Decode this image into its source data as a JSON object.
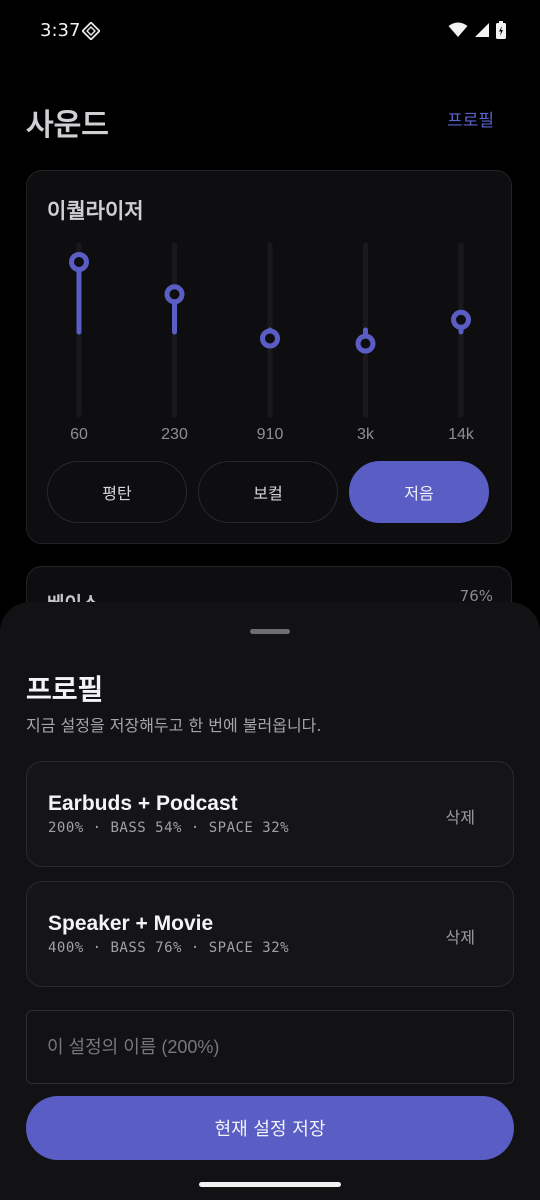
{
  "status_bar": {
    "time": "3:37",
    "icons": [
      "app-notification-icon",
      "wifi-icon",
      "cell-signal-icon",
      "battery-charging-icon"
    ]
  },
  "header": {
    "title": "사운드",
    "profile_link": "프로필"
  },
  "equalizer": {
    "title": "이퀄라이저",
    "accent_color": "#5a5ec4",
    "bands": [
      {
        "label": "60",
        "level": 0.9
      },
      {
        "label": "230",
        "level": 0.71
      },
      {
        "label": "910",
        "level": 0.45
      },
      {
        "label": "3k",
        "level": 0.42
      },
      {
        "label": "14k",
        "level": 0.56
      }
    ],
    "presets": [
      {
        "label": "평탄",
        "active": false
      },
      {
        "label": "보컬",
        "active": false
      },
      {
        "label": "저음",
        "active": true
      }
    ]
  },
  "bass_card": {
    "label": "베이스",
    "value": "76%"
  },
  "sheet": {
    "title": "프로필",
    "subtitle": "지금 설정을 저장해두고 한 번에 불러옵니다.",
    "profiles": [
      {
        "name": "Earbuds + Podcast",
        "meta": "200% · BASS 54% · SPACE 32%",
        "delete_label": "삭제"
      },
      {
        "name": "Speaker + Movie",
        "meta": "400% · BASS 76% · SPACE 32%",
        "delete_label": "삭제"
      }
    ],
    "name_input": {
      "placeholder": "이 설정의 이름 (200%)",
      "value": ""
    },
    "save_label": "현재 설정 저장"
  }
}
